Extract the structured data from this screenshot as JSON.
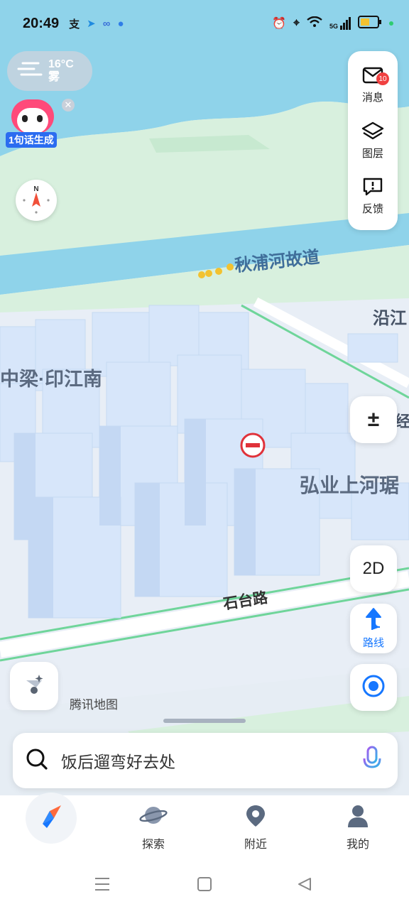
{
  "status_bar": {
    "time": "20:49",
    "signal": "5G",
    "icons": [
      "zhifubao-icon",
      "telegram-icon",
      "link-icon",
      "app-icon",
      "alarm-icon",
      "location-icon",
      "wifi-icon",
      "signal-icon",
      "battery-icon"
    ]
  },
  "weather": {
    "temperature": "16°C",
    "condition": "雾"
  },
  "mascot": {
    "label": "1句话生成"
  },
  "right_panel": {
    "messages_label": "消息",
    "messages_badge": "10",
    "layers_label": "图层",
    "feedback_label": "反馈"
  },
  "map": {
    "labels": {
      "river": "秋浦河故道",
      "road_top_right": "沿江",
      "district_left": "中梁·印江南",
      "district_right": "弘业上河琚",
      "road_bottom": "石台路",
      "road_right_edge": "经"
    },
    "brand": "腾讯地图",
    "colors": {
      "water": "#8fd3ea",
      "land": "#d8f0de",
      "buildings": "#d9e8fb",
      "road_green": "#6fd59a"
    }
  },
  "controls": {
    "zoom_label": "±",
    "mode_label": "2D",
    "route_label": "路线"
  },
  "search": {
    "placeholder": "饭后遛弯好去处"
  },
  "bottom_nav": {
    "explore": "探索",
    "nearby": "附近",
    "mine": "我的"
  }
}
